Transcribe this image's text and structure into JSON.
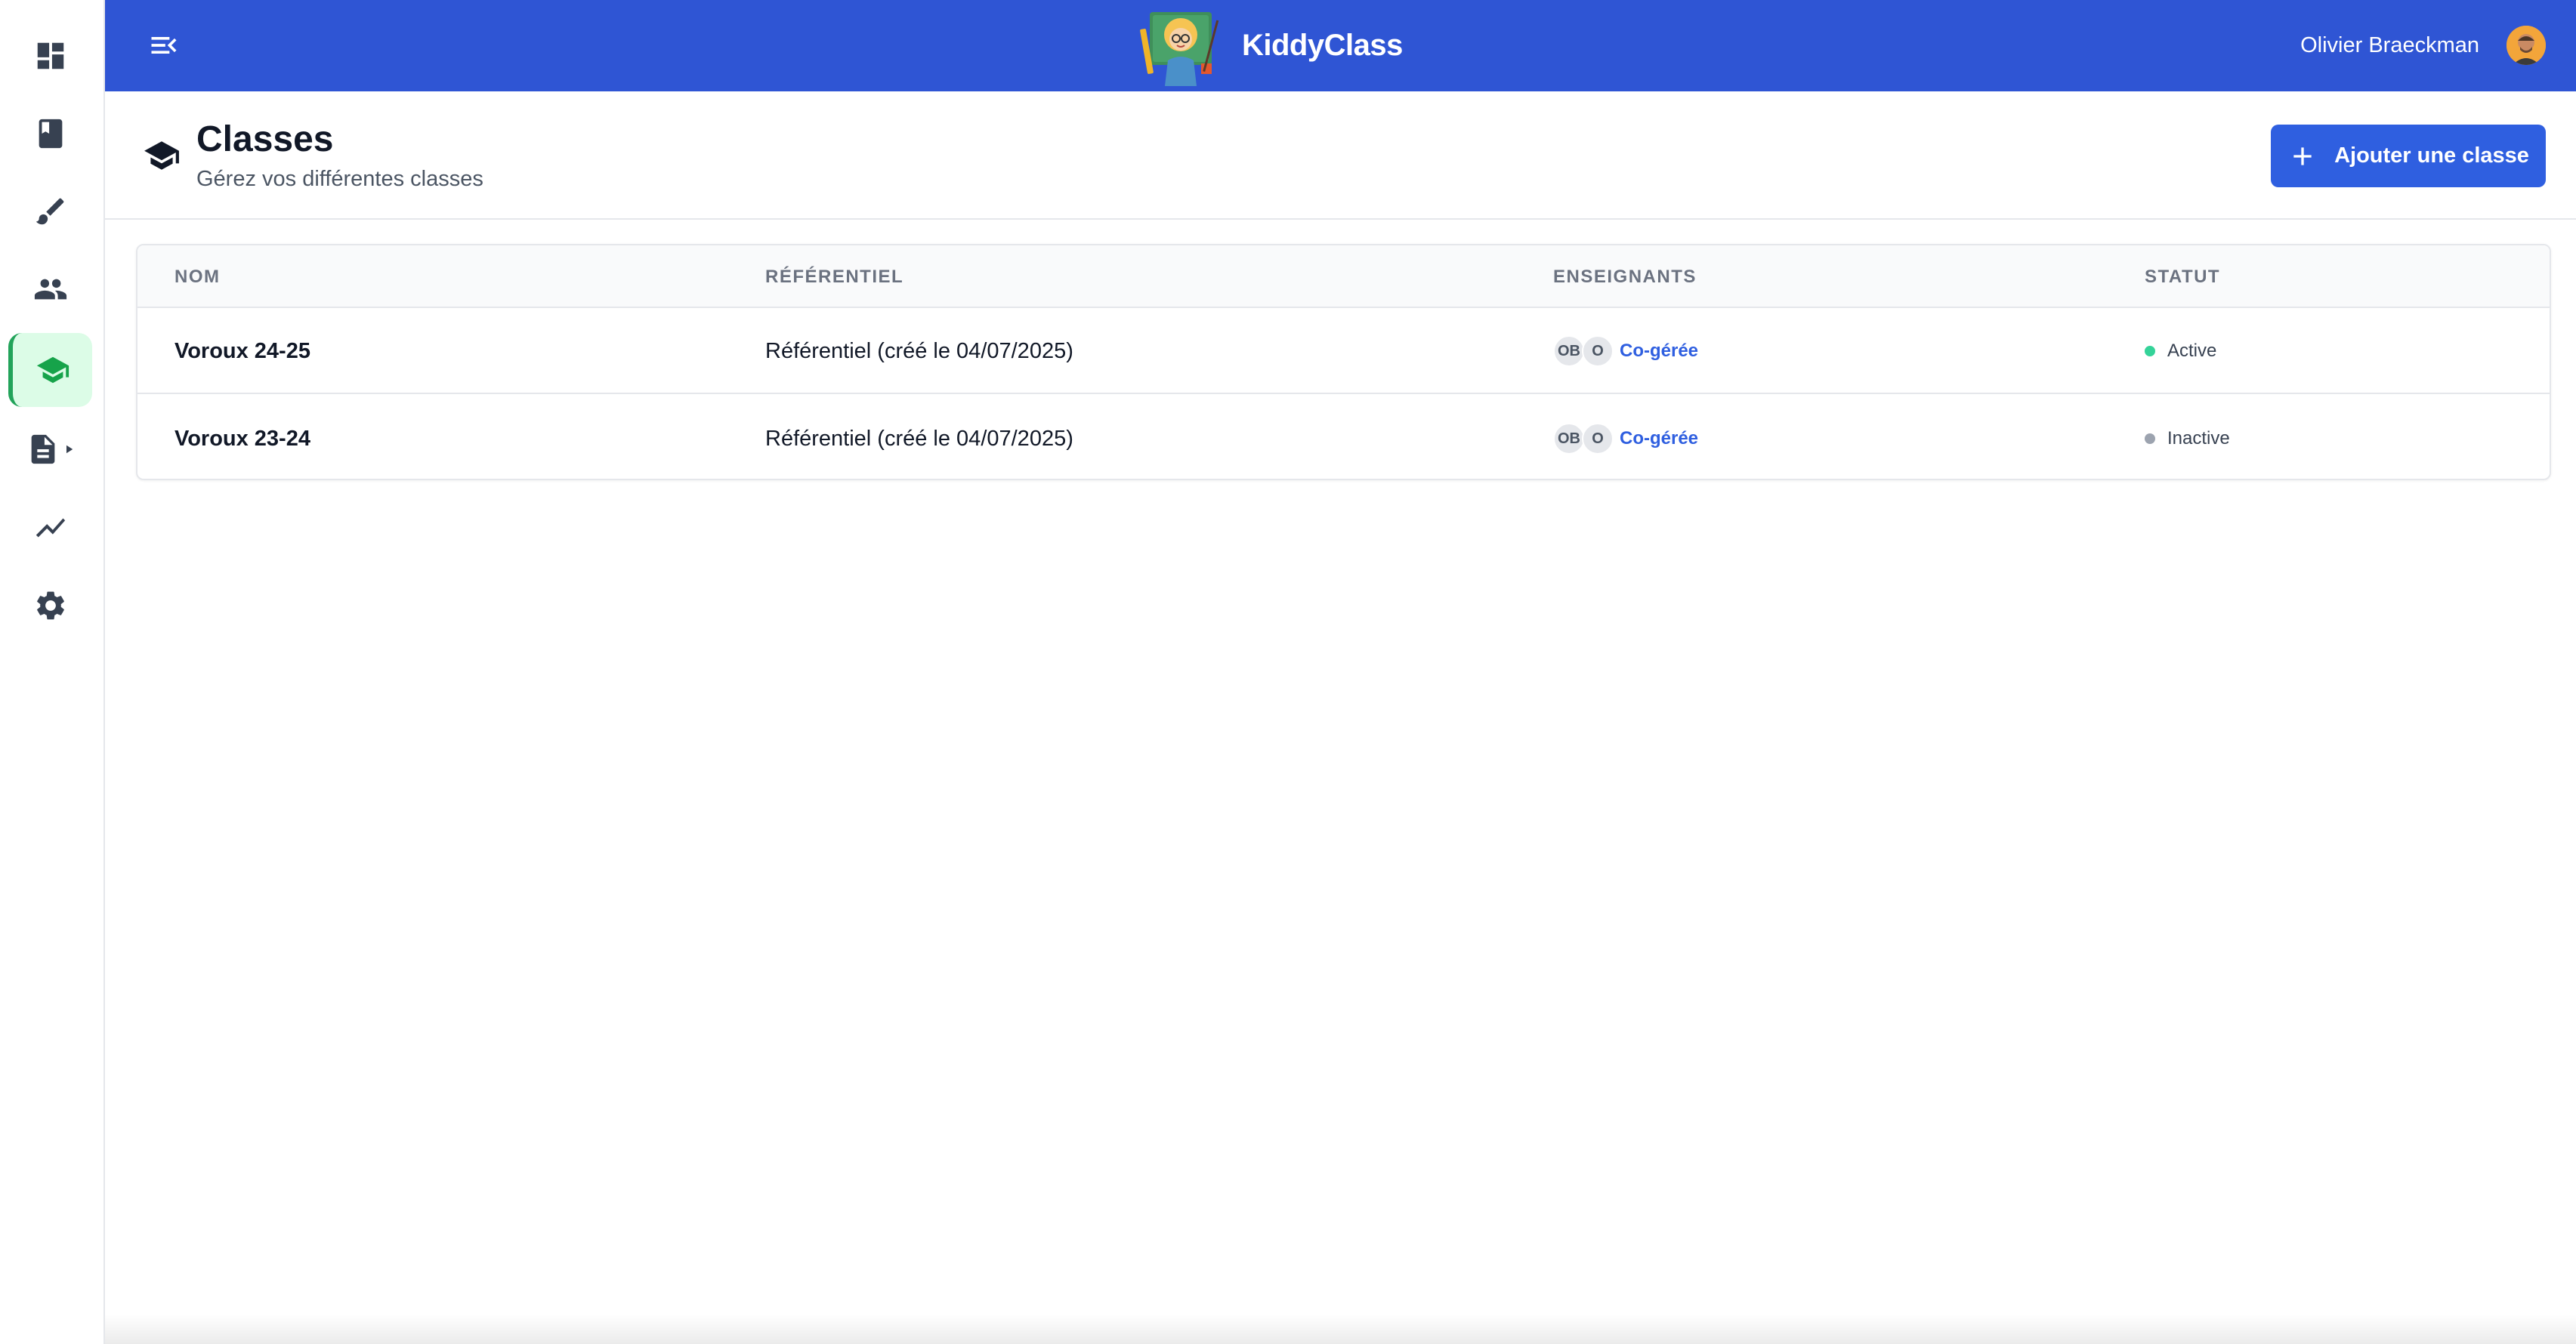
{
  "app": {
    "name": "KiddyClass",
    "brand_color": "#2f55d4",
    "accent_color": "#2f5fe0"
  },
  "header": {
    "user_name": "Olivier Braeckman",
    "menu_icon": "menu-collapse-icon",
    "logo": "teacher-mascot-logo"
  },
  "sidebar": {
    "items": [
      {
        "name": "dashboard",
        "icon": "dashboard-icon",
        "active": false
      },
      {
        "name": "book",
        "icon": "book-icon",
        "active": false
      },
      {
        "name": "brush",
        "icon": "brush-icon",
        "active": false
      },
      {
        "name": "people",
        "icon": "people-icon",
        "active": false
      },
      {
        "name": "classes",
        "icon": "graduation-cap-icon",
        "active": true
      },
      {
        "name": "documents",
        "icon": "document-expand-icon",
        "active": false
      },
      {
        "name": "stats",
        "icon": "trending-icon",
        "active": false
      },
      {
        "name": "settings",
        "icon": "gear-icon",
        "active": false
      }
    ]
  },
  "page": {
    "title": "Classes",
    "subtitle": "Gérez vos différentes classes",
    "add_button_label": "Ajouter une classe"
  },
  "table": {
    "columns": [
      "NOM",
      "RÉFÉRENTIEL",
      "ENSEIGNANTS",
      "STATUT"
    ],
    "rows": [
      {
        "name": "Voroux 24-25",
        "referentiel": "Référentiel (créé le 04/07/2025)",
        "teachers": [
          "OB",
          "O"
        ],
        "management": "Co-gérée",
        "status": "Active",
        "status_color": "#34d399"
      },
      {
        "name": "Voroux 23-24",
        "referentiel": "Référentiel (créé le 04/07/2025)",
        "teachers": [
          "OB",
          "O"
        ],
        "management": "Co-gérée",
        "status": "Inactive",
        "status_color": "#9ca3af"
      }
    ]
  }
}
